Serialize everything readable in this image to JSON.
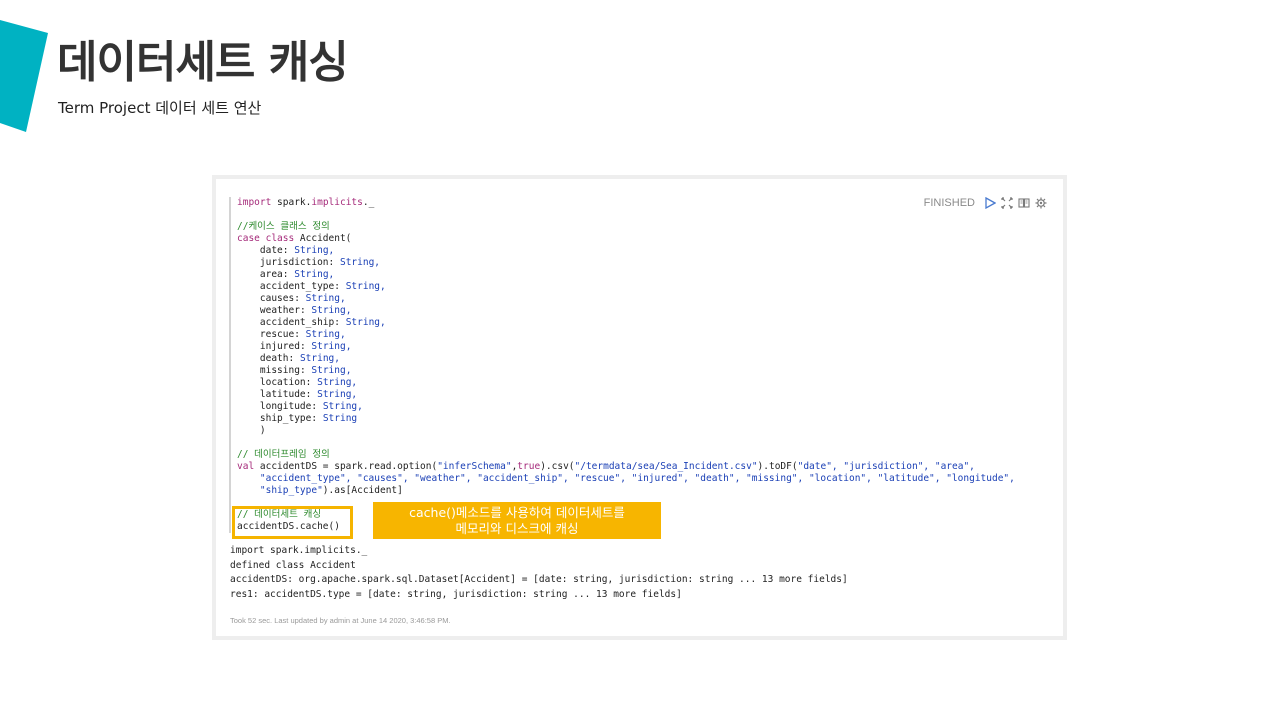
{
  "colors": {
    "accent": "#00b2c2",
    "highlight": "#f7b500",
    "keyword": "#a52a7a",
    "comment": "#2d8a2d",
    "string": "#1a3fb5"
  },
  "slide": {
    "title": "데이터세트 캐싱",
    "subtitle": "Term Project 데이터 세트 연산"
  },
  "notebook": {
    "status": "FINISHED",
    "toolbar_icons": [
      "play-icon",
      "expand-icon",
      "book-icon",
      "gear-icon"
    ],
    "code": {
      "import_kw": "import",
      "import_rest": " spark.",
      "import_impl": "implicits",
      "import_tail": "._",
      "comment_case": "//케이스 클래스 정의",
      "case_kw": "case class",
      "case_name": " Accident(",
      "fields": [
        {
          "name": "date",
          "type": "String,"
        },
        {
          "name": "jurisdiction",
          "type": "String,"
        },
        {
          "name": "area",
          "type": "String,"
        },
        {
          "name": "accident_type",
          "type": "String,"
        },
        {
          "name": "causes",
          "type": "String,"
        },
        {
          "name": "weather",
          "type": "String,"
        },
        {
          "name": "accident_ship",
          "type": "String,"
        },
        {
          "name": "rescue",
          "type": "String,"
        },
        {
          "name": "injured",
          "type": "String,"
        },
        {
          "name": "death",
          "type": "String,"
        },
        {
          "name": "missing",
          "type": "String,"
        },
        {
          "name": "location",
          "type": "String,"
        },
        {
          "name": "latitude",
          "type": "String,"
        },
        {
          "name": "longitude",
          "type": "String,"
        },
        {
          "name": "ship_type",
          "type": "String"
        }
      ],
      "close_paren": "    )",
      "comment_df": "// 데이터프레임 정의",
      "val_kw": "val",
      "df_line1_a": " accidentDS = spark.read.option(",
      "df_line1_s1": "\"inferSchema\"",
      "df_line1_b": ",",
      "df_line1_true": "true",
      "df_line1_c": ").csv(",
      "df_line1_s2": "\"/termdata/sea/Sea_Incident.csv\"",
      "df_line1_d": ").toDF(",
      "df_line1_s3": "\"date\", \"jurisdiction\", \"area\",",
      "df_line2": "    \"accident_type\", \"causes\", \"weather\", \"accident_ship\", \"rescue\", \"injured\", \"death\", \"missing\", \"location\", \"latitude\", \"longitude\",",
      "df_line3_s": "    \"ship_type\"",
      "df_line3_rest": ").as[Accident]",
      "comment_cache": "// 데이터세트 캐싱",
      "cache_call": "accidentDS.cache()"
    },
    "callout": {
      "line1": "cache()메소드를 사용하여 데이터세트를",
      "line2": "메모리와 디스크에 캐싱"
    },
    "output": [
      "import spark.implicits._",
      "defined class Accident",
      "accidentDS: org.apache.spark.sql.Dataset[Accident] = [date: string, jurisdiction: string ... 13 more fields]",
      "res1: accidentDS.type = [date: string, jurisdiction: string ... 13 more fields]"
    ],
    "footer": "Took 52 sec. Last updated by admin at June 14 2020, 3:46:58 PM."
  }
}
